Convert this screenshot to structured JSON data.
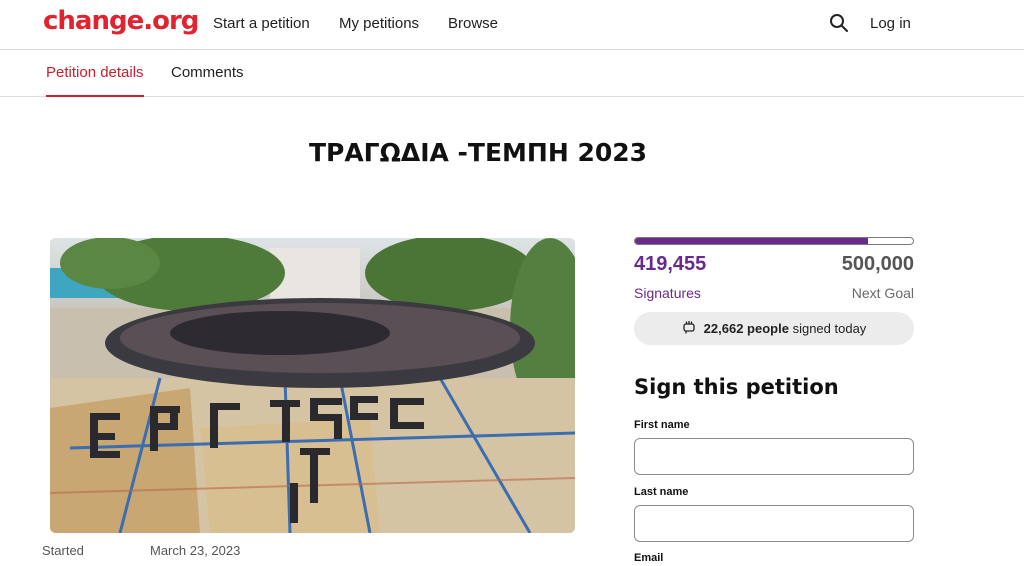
{
  "header": {
    "logo": "change.org",
    "nav": [
      "Start a petition",
      "My petitions",
      "Browse"
    ],
    "search_icon": "search-icon",
    "login_label": "Log in"
  },
  "tabs": [
    {
      "label": "Petition details",
      "active": true
    },
    {
      "label": "Comments",
      "active": false
    }
  ],
  "petition": {
    "title": "ΤΡΑΓΩΔΙΑ -ΤΕΜΠΗ 2023",
    "started_label": "Started",
    "started_date": "March 23, 2023"
  },
  "progress": {
    "signatures": "419,455",
    "signatures_label": "Signatures",
    "goal": "500,000",
    "goal_label": "Next Goal",
    "fraction": 0.839,
    "today_count": "22,662 people",
    "today_text": "signed today",
    "today_icon": "raised-fist-icon"
  },
  "form": {
    "heading": "Sign this petition",
    "first_name_label": "First name",
    "last_name_label": "Last name",
    "email_label": "Email"
  },
  "colors": {
    "brand": "#e0232e",
    "progress": "#6a2a8c"
  }
}
